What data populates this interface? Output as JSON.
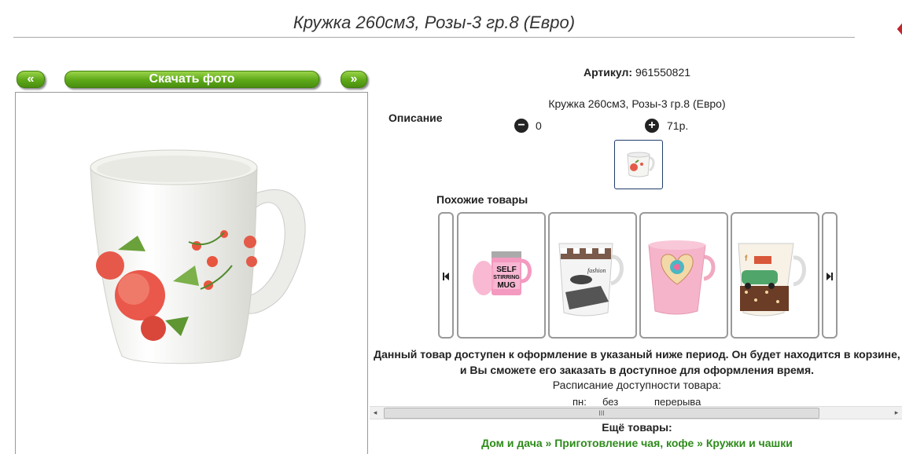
{
  "title": "Кружка 260см3, Розы-3 гр.8 (Евро)",
  "nav": {
    "prev_label": "«",
    "download_label": "Скачать фото",
    "next_label": "»"
  },
  "article": {
    "label": "Артикул:",
    "value": "961550821"
  },
  "description": {
    "label": "Описание",
    "text": "Кружка 260см3, Розы-3 гр.8 (Евро)"
  },
  "quantity": {
    "minus_icon": "minus-circle-icon",
    "value": "0",
    "plus_icon": "plus-circle-icon",
    "price": "71р."
  },
  "similar": {
    "title": "Похожие товары",
    "items": [
      {
        "name": "self-stirring-mug",
        "text_line1": "SELF",
        "text_line2": "STIRRING",
        "text_line3": "MUG"
      },
      {
        "name": "fashion-mug"
      },
      {
        "name": "heart-pink-mug"
      },
      {
        "name": "car-cafe-mug"
      }
    ]
  },
  "availability": {
    "line1": "Данный товар доступен к оформление в указаный ниже период. Он будет находится в корзине,",
    "line2": "и Вы сможете его заказать в доступное для оформления время.",
    "schedule_label": "Расписание доступности товара:",
    "day": "пн:",
    "from": "без",
    "to": "перерыва"
  },
  "more": {
    "title": "Ещё товары:",
    "crumbs": [
      "Дом и дача",
      "Приготовление чая, кофе",
      "Кружки и чашки"
    ],
    "separator": "»"
  },
  "scrollbar": {
    "left_arrow": "◂",
    "grip": "III",
    "right_arrow": "▸"
  },
  "colors": {
    "accent_green": "#5da818",
    "link_green": "#2e8b1a",
    "thumb_border": "#1e3d6b"
  }
}
